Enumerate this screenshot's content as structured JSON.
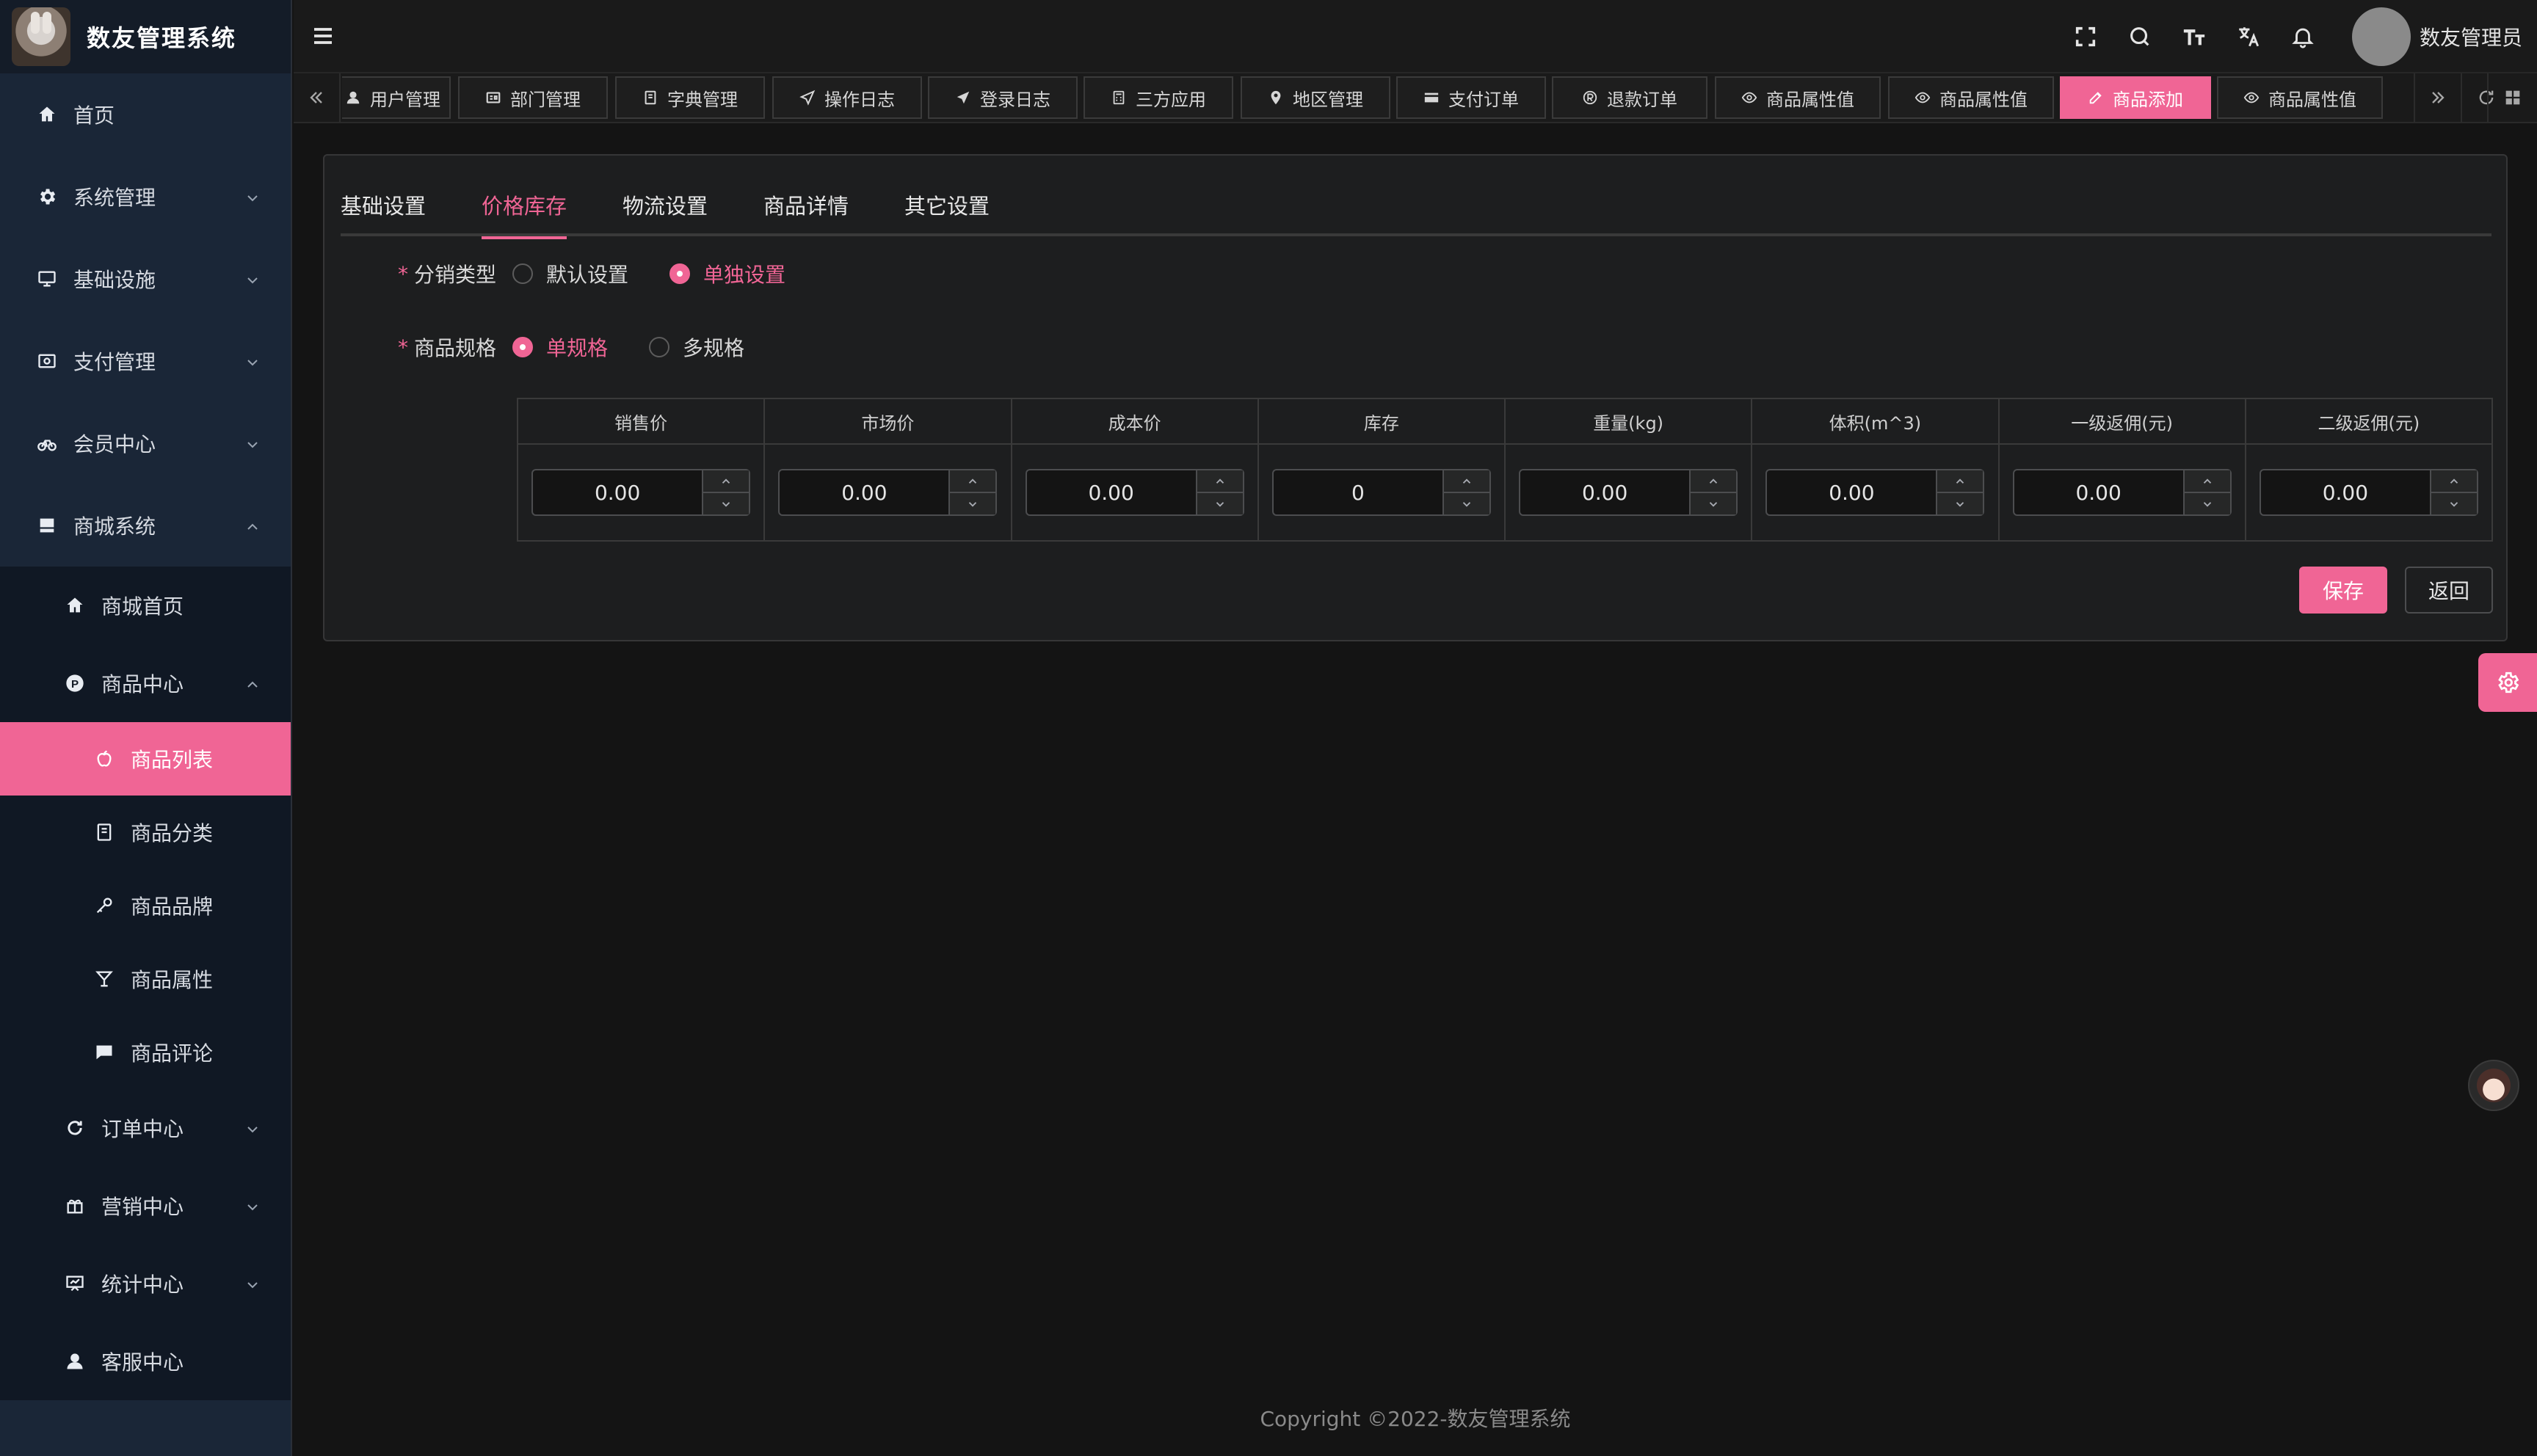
{
  "app": {
    "title": "数友管理系统",
    "username": "数友管理员"
  },
  "sidebar": {
    "items": [
      {
        "label": "首页",
        "icon": "home-icon"
      },
      {
        "label": "系统管理",
        "icon": "gear-icon"
      },
      {
        "label": "基础设施",
        "icon": "monitor-icon"
      },
      {
        "label": "支付管理",
        "icon": "payment-icon"
      },
      {
        "label": "会员中心",
        "icon": "bike-icon"
      },
      {
        "label": "商城系统",
        "icon": "shop-icon"
      },
      {
        "label": "商城首页",
        "icon": "home-icon"
      },
      {
        "label": "商品中心",
        "icon": "p-badge-icon"
      },
      {
        "label": "商品列表",
        "icon": "apple-icon"
      },
      {
        "label": "商品分类",
        "icon": "notebook-icon"
      },
      {
        "label": "商品品牌",
        "icon": "key-icon"
      },
      {
        "label": "商品属性",
        "icon": "cocktail-icon"
      },
      {
        "label": "商品评论",
        "icon": "comment-icon"
      },
      {
        "label": "订单中心",
        "icon": "refresh-icon"
      },
      {
        "label": "营销中心",
        "icon": "gift-icon"
      },
      {
        "label": "统计中心",
        "icon": "chart-icon"
      },
      {
        "label": "客服中心",
        "icon": "user-icon"
      }
    ]
  },
  "tags": [
    {
      "label": "用户管理"
    },
    {
      "label": "部门管理"
    },
    {
      "label": "字典管理"
    },
    {
      "label": "操作日志"
    },
    {
      "label": "登录日志"
    },
    {
      "label": "三方应用"
    },
    {
      "label": "地区管理"
    },
    {
      "label": "支付订单"
    },
    {
      "label": "退款订单"
    },
    {
      "label": "商品属性值"
    },
    {
      "label": "商品属性值"
    },
    {
      "label": "商品添加"
    },
    {
      "label": "商品属性值"
    }
  ],
  "form": {
    "tabs": [
      "基础设置",
      "价格库存",
      "物流设置",
      "商品详情",
      "其它设置"
    ],
    "active_tab": "价格库存",
    "distribution": {
      "label": "分销类型",
      "options": [
        "默认设置",
        "单独设置"
      ],
      "selected": "单独设置"
    },
    "spec": {
      "label": "商品规格",
      "options": [
        "单规格",
        "多规格"
      ],
      "selected": "单规格"
    },
    "table": {
      "headers": [
        "销售价",
        "市场价",
        "成本价",
        "库存",
        "重量(kg)",
        "体积(m^3)",
        "一级返佣(元)",
        "二级返佣(元)"
      ],
      "values": [
        "0.00",
        "0.00",
        "0.00",
        "0",
        "0.00",
        "0.00",
        "0.00",
        "0.00"
      ]
    },
    "save_label": "保存",
    "back_label": "返回"
  },
  "footer": {
    "copyright": "Copyright ©2022-数友管理系统"
  },
  "colors": {
    "accent": "#f06595",
    "sidebar_bg": "#1a2637",
    "page_bg": "#141414"
  }
}
